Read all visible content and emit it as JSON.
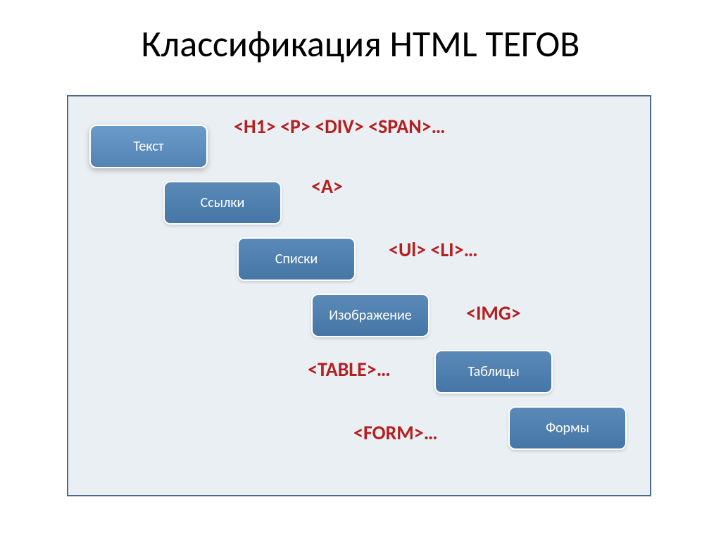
{
  "title": "Классификация HTML ТЕГОВ",
  "steps": [
    {
      "label": "Текст",
      "tags": "<H1> <P> <DIV> <SPAN>…",
      "active": true
    },
    {
      "label": "Ссылки",
      "tags": "<A>",
      "active": false
    },
    {
      "label": "Списки",
      "tags": "<Ul> <LI>…",
      "active": false
    },
    {
      "label": "Изображение",
      "tags": "<IMG>",
      "active": false
    },
    {
      "label": "Таблицы",
      "tags": "<TABLE>…",
      "active": false
    },
    {
      "label": "Формы",
      "tags": "<FORM>…",
      "active": false
    }
  ]
}
